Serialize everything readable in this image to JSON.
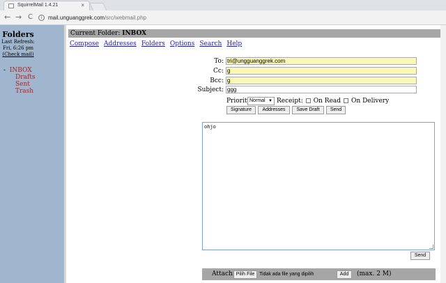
{
  "browser": {
    "tab_title": "SquirrelMail 1.4.21",
    "tab_close": "×",
    "url_host": "mail.unguanggrek.com",
    "url_path": "/src/webmail.php",
    "back": "←",
    "forward": "→",
    "reload": "C"
  },
  "left": {
    "title": "Folders",
    "last_refresh_label": "Last Refresh:",
    "last_refresh_time": "Fri, 6:26 pm",
    "check_mail": "(Check mail)",
    "inbox_prefix": "-",
    "inbox": "INBOX",
    "folders": [
      "Drafts",
      "Sent",
      "Trash"
    ]
  },
  "header": {
    "current_folder_label": "Current Folder:",
    "current_folder": "INBOX"
  },
  "menu": [
    "Compose",
    "Addresses",
    "Folders",
    "Options",
    "Search",
    "Help"
  ],
  "compose": {
    "to_label": "To:",
    "to_value": "tri@ungguanggrek.com",
    "cc_label": "Cc:",
    "cc_value": "g",
    "bcc_label": "Bcc:",
    "bcc_value": "g",
    "subject_label": "Subject:",
    "subject_value": "ggg",
    "priority_label": "Priority:",
    "priority_value": "Normal",
    "receipt_label": "Receipt:",
    "on_read": "On Read",
    "on_delivery": "On Delivery",
    "buttons": {
      "signature": "Signature",
      "addresses": "Addresses",
      "save_draft": "Save Draft",
      "send": "Send"
    },
    "body": "ohjo",
    "send_bottom": "Send"
  },
  "attach": {
    "label": "Attach:",
    "choose_file": "Pilih File",
    "no_file": "Tidak ada file yang dipilih",
    "add": "Add",
    "max": "(max. 2 M)"
  },
  "colors": {
    "left_frame": "#9fb6ce",
    "highlight_field": "#faf8b6",
    "link": "#1d1da8",
    "folder_link": "#9e2a2b",
    "bar": "#a6a6a6"
  }
}
